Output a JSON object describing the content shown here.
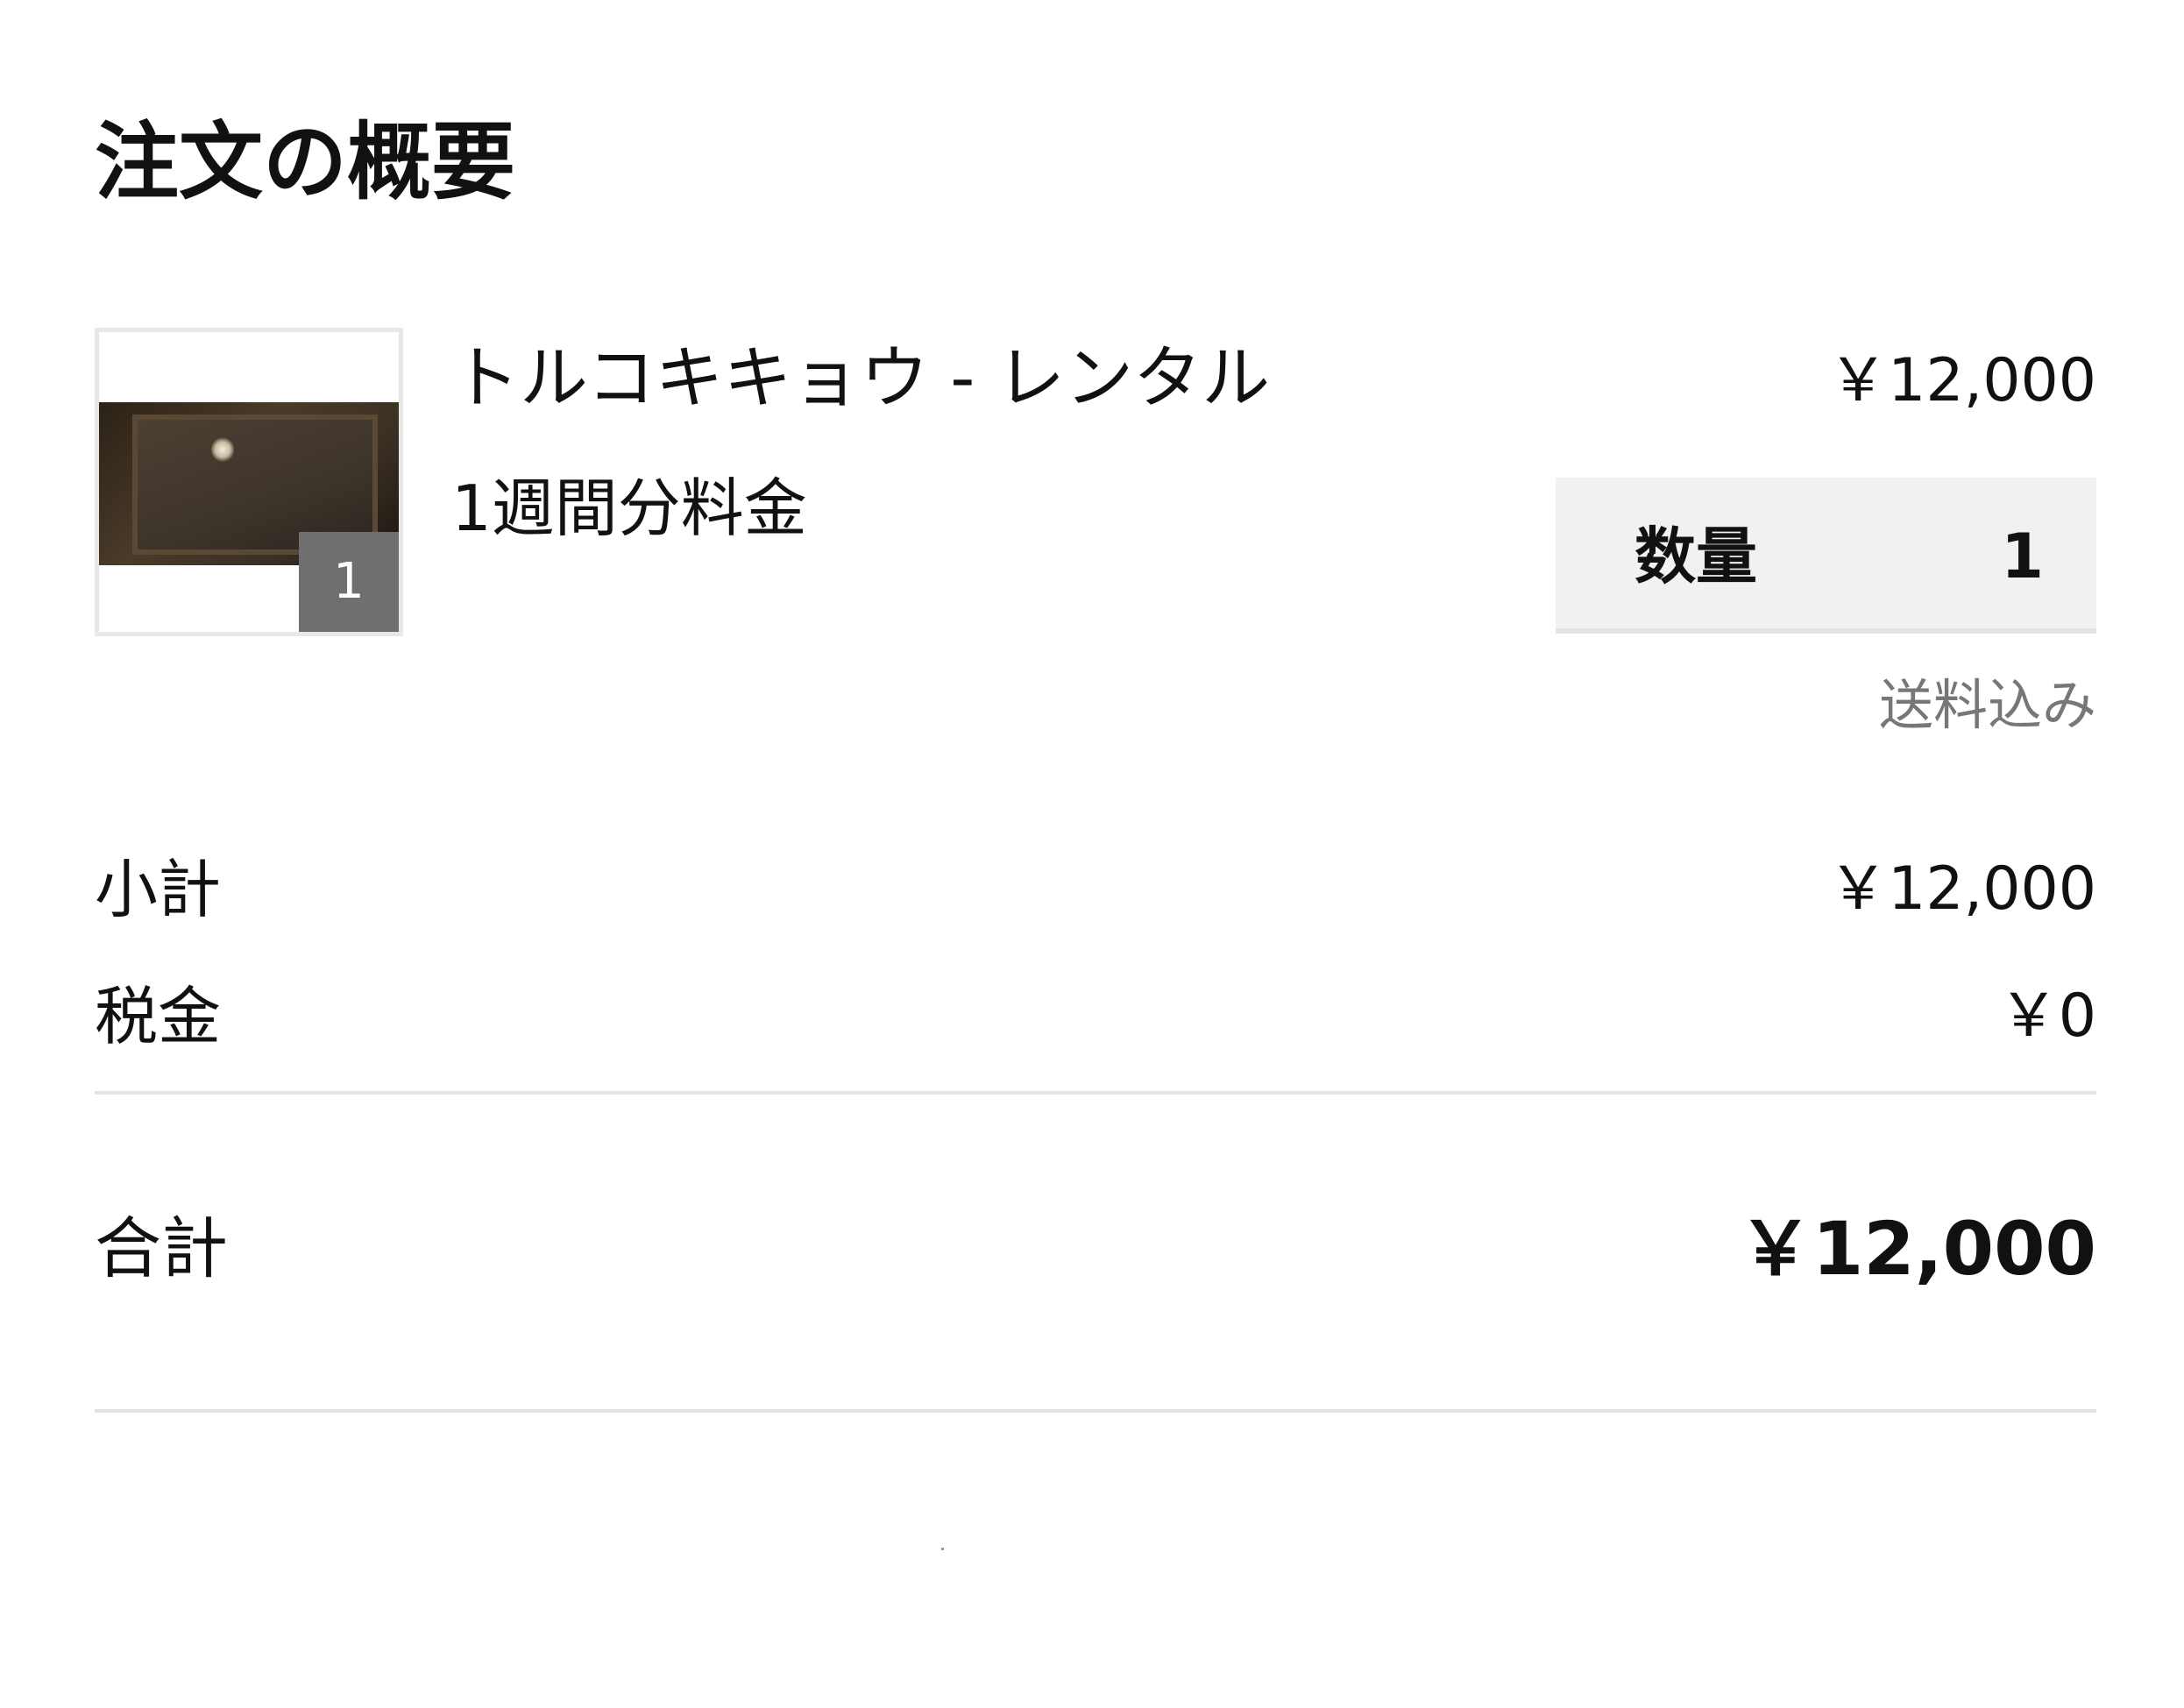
{
  "page": {
    "title": "注文の概要"
  },
  "line_item": {
    "name": "トルコキキョウ - レンタル",
    "variant": "1週間分料金",
    "price": "￥12,000",
    "thumbnail_badge": "1",
    "quantity_label": "数量",
    "quantity_value": "1",
    "shipping_note": "送料込み"
  },
  "summary": {
    "subtotal_label": "小計",
    "subtotal_value": "￥12,000",
    "tax_label": "税金",
    "tax_value": "￥0",
    "total_label": "合計",
    "total_value": "￥12,000"
  },
  "colors": {
    "text": "#111111",
    "muted": "#777777",
    "badge_bg": "#6f6f6f",
    "qty_box_bg": "#f1f1f1",
    "divider": "#e3e3e3"
  }
}
